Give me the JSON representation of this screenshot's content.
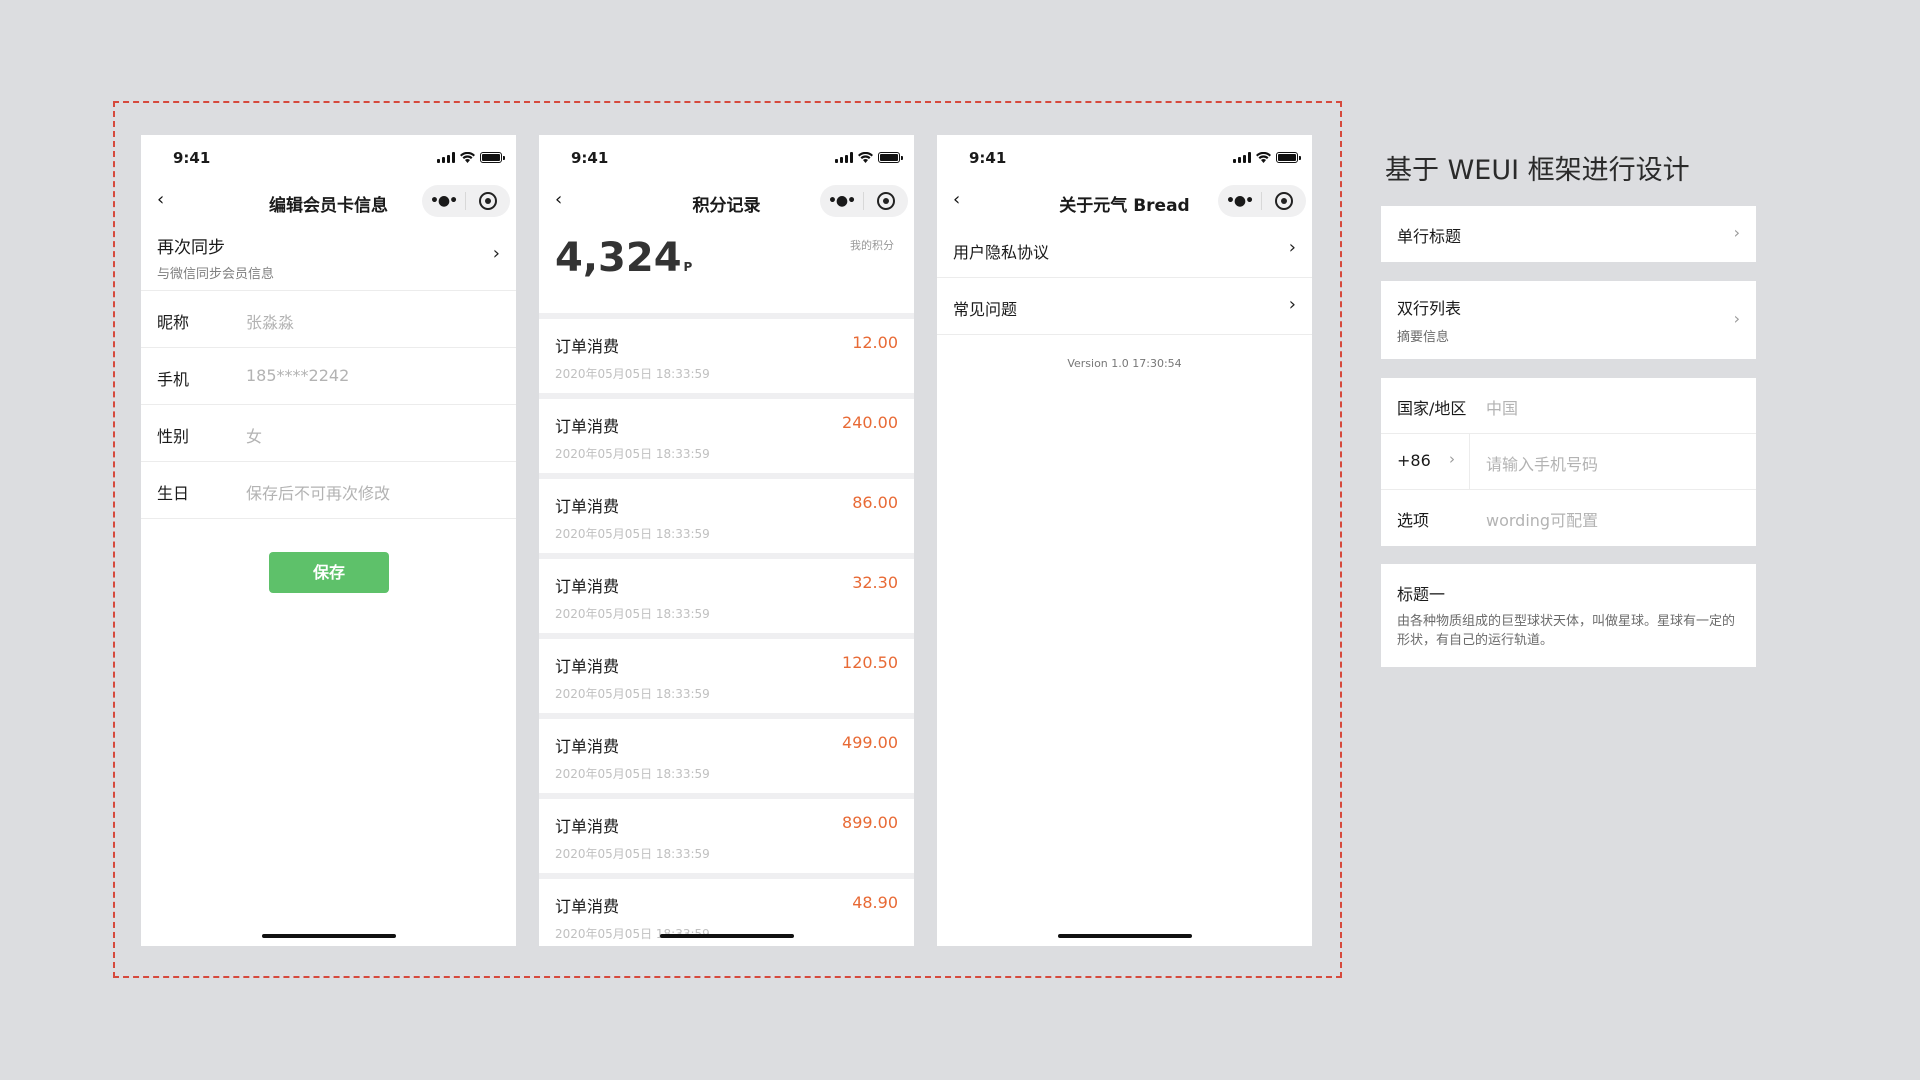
{
  "status": {
    "time": "9:41"
  },
  "phone1": {
    "title": "编辑会员卡信息",
    "sync": {
      "title": "再次同步",
      "subtitle": "与微信同步会员信息"
    },
    "fields": [
      {
        "label": "昵称",
        "value": "张淼淼"
      },
      {
        "label": "手机",
        "value": "185****2242"
      },
      {
        "label": "性别",
        "value": "女"
      },
      {
        "label": "生日",
        "value": "保存后不可再次修改"
      }
    ],
    "save_label": "保存"
  },
  "phone2": {
    "title": "积分记录",
    "points": "4,324",
    "points_unit": "P",
    "points_label": "我的积分",
    "orders": [
      {
        "title": "订单消费",
        "amount": "12.00",
        "time": "2020年05月05日 18:33:59"
      },
      {
        "title": "订单消费",
        "amount": "240.00",
        "time": "2020年05月05日 18:33:59"
      },
      {
        "title": "订单消费",
        "amount": "86.00",
        "time": "2020年05月05日 18:33:59"
      },
      {
        "title": "订单消费",
        "amount": "32.30",
        "time": "2020年05月05日 18:33:59"
      },
      {
        "title": "订单消费",
        "amount": "120.50",
        "time": "2020年05月05日 18:33:59"
      },
      {
        "title": "订单消费",
        "amount": "499.00",
        "time": "2020年05月05日 18:33:59"
      },
      {
        "title": "订单消费",
        "amount": "899.00",
        "time": "2020年05月05日 18:33:59"
      },
      {
        "title": "订单消费",
        "amount": "48.90",
        "time": "2020年05月05日 18:33:59"
      }
    ]
  },
  "phone3": {
    "title": "关于元气 Bread",
    "items": [
      {
        "label": "用户隐私协议"
      },
      {
        "label": "常见问题"
      }
    ],
    "version": "Version 1.0 17:30:54"
  },
  "panel": {
    "title": "基于 WEUI 框架进行设计",
    "single": {
      "title": "单行标题"
    },
    "double": {
      "title": "双行列表",
      "subtitle": "摘要信息"
    },
    "form": {
      "country_label": "国家/地区",
      "country_value": "中国",
      "code_label": "+86",
      "phone_placeholder": "请输入手机号码",
      "option_label": "选项",
      "option_value": "wording可配置"
    },
    "article": {
      "title": "标题一",
      "desc": "由各种物质组成的巨型球状天体，叫做星球。星球有一定的形状，有自己的运行轨道。"
    }
  },
  "colors": {
    "accent": "#5ec16a",
    "amount": "#e86a35",
    "frame": "#d6493c"
  }
}
